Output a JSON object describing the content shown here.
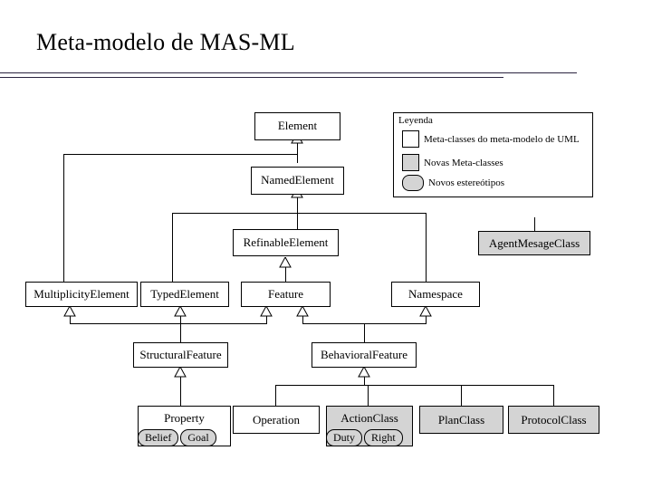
{
  "slide": {
    "title": "Meta-modelo de MAS-ML"
  },
  "legend": {
    "title": "Leyenda",
    "items": [
      {
        "swatch": "white-square",
        "label": "Meta-classes do meta-modelo de UML"
      },
      {
        "swatch": "gray-square",
        "label": "Novas Meta-classes"
      },
      {
        "swatch": "gray-rounded",
        "label": "Novos estereótipos"
      }
    ]
  },
  "diagram": {
    "type": "uml-class-diagram",
    "colors": {
      "uml_metaclass_fill": "#ffffff",
      "new_metaclass_fill": "#d4d4d4",
      "stereotype_fill": "#d4d4d4",
      "stroke": "#000000"
    },
    "nodes": [
      {
        "id": "element",
        "label": "Element",
        "kind": "uml-metaclass"
      },
      {
        "id": "namedElement",
        "label": "NamedElement",
        "kind": "uml-metaclass"
      },
      {
        "id": "refinableElement",
        "label": "RefinableElement",
        "kind": "uml-metaclass"
      },
      {
        "id": "agentMesageClass",
        "label": "AgentMesageClass",
        "kind": "new-metaclass"
      },
      {
        "id": "multiplicityElement",
        "label": "MultiplicityElement",
        "kind": "uml-metaclass"
      },
      {
        "id": "typedElement",
        "label": "TypedElement",
        "kind": "uml-metaclass"
      },
      {
        "id": "feature",
        "label": "Feature",
        "kind": "uml-metaclass"
      },
      {
        "id": "namespace",
        "label": "Namespace",
        "kind": "uml-metaclass"
      },
      {
        "id": "structuralFeature",
        "label": "StructuralFeature",
        "kind": "uml-metaclass"
      },
      {
        "id": "behavioralFeature",
        "label": "BehavioralFeature",
        "kind": "uml-metaclass"
      },
      {
        "id": "property",
        "label": "Property",
        "kind": "uml-metaclass"
      },
      {
        "id": "operation",
        "label": "Operation",
        "kind": "uml-metaclass"
      },
      {
        "id": "actionClass",
        "label": "ActionClass",
        "kind": "new-metaclass"
      },
      {
        "id": "planClass",
        "label": "PlanClass",
        "kind": "new-metaclass"
      },
      {
        "id": "protocolClass",
        "label": "ProtocolClass",
        "kind": "new-metaclass"
      }
    ],
    "stereotypes": [
      {
        "id": "belief",
        "label": "Belief",
        "owner": "property"
      },
      {
        "id": "goal",
        "label": "Goal",
        "owner": "property"
      },
      {
        "id": "duty",
        "label": "Duty",
        "owner": "actionClass"
      },
      {
        "id": "right",
        "label": "Right",
        "owner": "actionClass"
      }
    ],
    "generalizations": [
      {
        "from": "namedElement",
        "to": "element"
      },
      {
        "from": "multiplicityElement",
        "to": "element"
      },
      {
        "from": "refinableElement",
        "to": "namedElement"
      },
      {
        "from": "typedElement",
        "to": "namedElement"
      },
      {
        "from": "namespace",
        "to": "namedElement"
      },
      {
        "from": "feature",
        "to": "refinableElement"
      },
      {
        "from": "structuralFeature",
        "to": "multiplicityElement"
      },
      {
        "from": "structuralFeature",
        "to": "typedElement"
      },
      {
        "from": "structuralFeature",
        "to": "feature"
      },
      {
        "from": "behavioralFeature",
        "to": "feature"
      },
      {
        "from": "behavioralFeature",
        "to": "namespace"
      },
      {
        "from": "property",
        "to": "structuralFeature"
      },
      {
        "from": "operation",
        "to": "behavioralFeature"
      },
      {
        "from": "actionClass",
        "to": "behavioralFeature"
      },
      {
        "from": "planClass",
        "to": "behavioralFeature"
      },
      {
        "from": "protocolClass",
        "to": "behavioralFeature"
      }
    ]
  }
}
